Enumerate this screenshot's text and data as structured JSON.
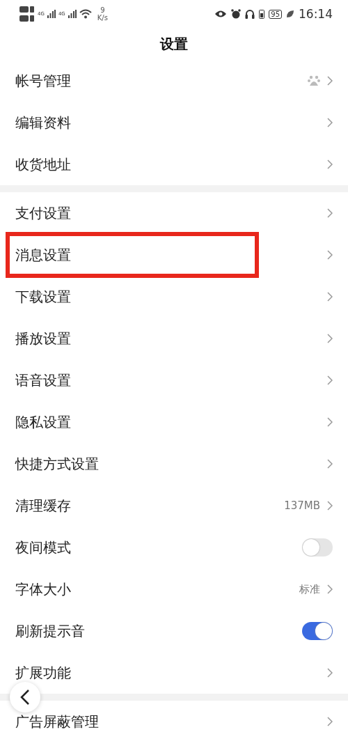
{
  "status_bar": {
    "network_type_1": "4G",
    "network_type_2": "4G",
    "speed_value": "9",
    "speed_unit": "K/s",
    "battery": "95",
    "time": "16:14"
  },
  "title": "设置",
  "groups": [
    {
      "items": [
        {
          "label": "帐号管理",
          "kind": "account",
          "highlighted": false
        },
        {
          "label": "编辑资料",
          "kind": "link",
          "highlighted": false
        },
        {
          "label": "收货地址",
          "kind": "link",
          "highlighted": false
        }
      ]
    },
    {
      "items": [
        {
          "label": "支付设置",
          "kind": "link",
          "highlighted": false
        },
        {
          "label": "消息设置",
          "kind": "link",
          "highlighted": true
        },
        {
          "label": "下载设置",
          "kind": "link",
          "highlighted": false
        },
        {
          "label": "播放设置",
          "kind": "link",
          "highlighted": false
        },
        {
          "label": "语音设置",
          "kind": "link",
          "highlighted": false
        },
        {
          "label": "隐私设置",
          "kind": "link",
          "highlighted": false
        },
        {
          "label": "快捷方式设置",
          "kind": "link",
          "highlighted": false
        },
        {
          "label": "清理缓存",
          "kind": "value",
          "value": "137MB",
          "highlighted": false
        },
        {
          "label": "夜间模式",
          "kind": "toggle",
          "on": false,
          "highlighted": false
        },
        {
          "label": "字体大小",
          "kind": "value",
          "value": "标准",
          "highlighted": false
        },
        {
          "label": "刷新提示音",
          "kind": "toggle",
          "on": true,
          "highlighted": false
        },
        {
          "label": "扩展功能",
          "kind": "link",
          "highlighted": false
        }
      ]
    },
    {
      "items": [
        {
          "label": "广告屏蔽管理",
          "kind": "link",
          "highlighted": false
        }
      ]
    }
  ]
}
